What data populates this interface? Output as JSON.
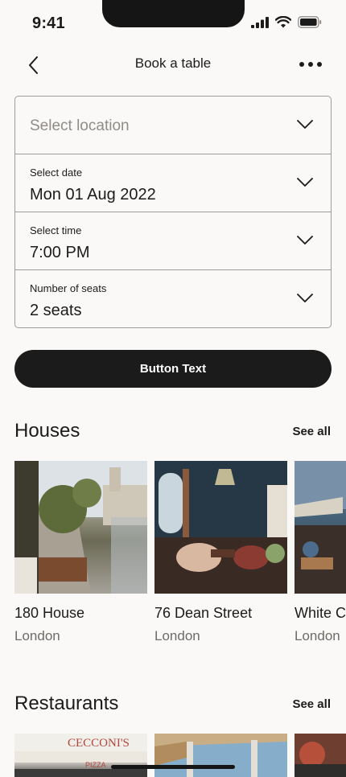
{
  "status": {
    "time": "9:41"
  },
  "nav": {
    "title": "Book a table"
  },
  "form": {
    "location": {
      "placeholder": "Select location"
    },
    "date": {
      "label": "Select date",
      "value": "Mon 01 Aug 2022"
    },
    "time": {
      "label": "Select time",
      "value": "7:00 PM"
    },
    "seats": {
      "label": "Number of seats",
      "value": "2 seats"
    }
  },
  "cta": {
    "label": "Button Text"
  },
  "houses": {
    "title": "Houses",
    "see_all": "See all",
    "items": [
      {
        "name": "180 House",
        "city": "London"
      },
      {
        "name": "76 Dean Street",
        "city": "London"
      },
      {
        "name": "White City House",
        "city": "London"
      }
    ]
  },
  "restaurants": {
    "title": "Restaurants",
    "see_all": "See all",
    "items": [
      {
        "sign": "CECCONI'S",
        "sub": "PIZZA"
      },
      {},
      {}
    ]
  },
  "icons": {
    "back": "chevron-left-icon",
    "more": "more-horizontal-icon",
    "dropdown": "chevron-down-icon",
    "signal": "signal-icon",
    "wifi": "wifi-icon",
    "battery": "battery-icon"
  }
}
